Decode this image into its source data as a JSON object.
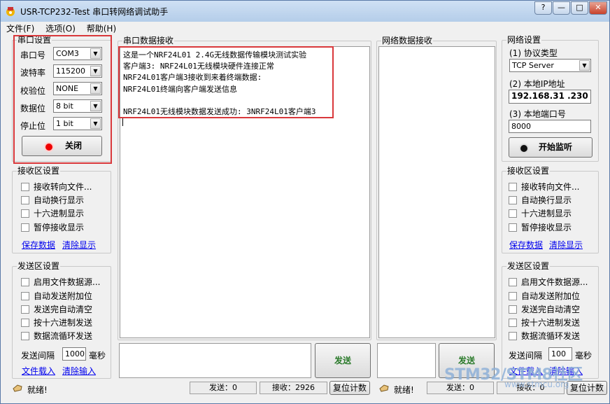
{
  "window": {
    "title": "USR-TCP232-Test 串口转网络调试助手",
    "btn_help": "?",
    "btn_min": "—",
    "btn_max": "□",
    "btn_close": "✕"
  },
  "menu": [
    "文件(F)",
    "选项(O)",
    "帮助(H)"
  ],
  "serial": {
    "title": "串口设置",
    "port_label": "串口号",
    "port": "COM3",
    "baud_label": "波特率",
    "baud": "115200",
    "parity_label": "校验位",
    "parity": "NONE",
    "data_label": "数据位",
    "data_bits": "8 bit",
    "stop_label": "停止位",
    "stop_bits": "1 bit",
    "close_btn": "关闭"
  },
  "left_recv": {
    "title": "接收区设置",
    "opts": [
      "接收转向文件...",
      "自动换行显示",
      "十六进制显示",
      "暂停接收显示"
    ],
    "save": "保存数据",
    "clear": "清除显示"
  },
  "left_send": {
    "title": "发送区设置",
    "opts": [
      "启用文件数据源...",
      "自动发送附加位",
      "发送完自动清空",
      "按十六进制发送",
      "数据流循环发送"
    ],
    "interval_label": "发送间隔",
    "interval": "1000",
    "interval_unit": "毫秒",
    "load": "文件载入",
    "clear": "清除输入"
  },
  "serial_recv": {
    "title": "串口数据接收",
    "lines": [
      "这是一个NRF24L01 2.4G无线数据传输模块测试实验",
      "客户端3: NRF24L01无线模块硬件连接正常",
      "NRF24L01客户端3接收到来着终端数据:",
      "NRF24L01终端向客户端发送信息",
      "",
      "NRF24L01无线模块数据发送成功: 3NRF24L01客户端3"
    ]
  },
  "net_recv": {
    "title": "网络数据接收"
  },
  "net": {
    "title": "网络设置",
    "proto_label": "(1) 协议类型",
    "proto": "TCP Server",
    "ip_label": "(2) 本地IP地址",
    "ip": "192.168.31 .230",
    "port_label": "(3) 本地端口号",
    "port": "8000",
    "listen_btn": "开始监听"
  },
  "right_recv": {
    "title": "接收区设置",
    "opts": [
      "接收转向文件...",
      "自动换行显示",
      "十六进制显示",
      "暂停接收显示"
    ],
    "save": "保存数据",
    "clear": "清除显示"
  },
  "right_send": {
    "title": "发送区设置",
    "opts": [
      "启用文件数据源...",
      "自动发送附加位",
      "发送完自动清空",
      "按十六进制发送",
      "数据流循环发送"
    ],
    "interval_label": "发送间隔",
    "interval": "100",
    "interval_unit": "毫秒",
    "load": "文件载入",
    "clear": "清除输入"
  },
  "send_btn": "发送",
  "status_left": {
    "ready": "就绪!",
    "sent": "发送：0",
    "recv": "接收：2926",
    "reset": "复位计数"
  },
  "status_right": {
    "ready": "就绪!",
    "sent": "发送：0",
    "recv": "接收：0",
    "reset": "复位计数"
  },
  "watermark": {
    "brand": "STM32/STM8社区",
    "url": "www.stmcu.org"
  }
}
